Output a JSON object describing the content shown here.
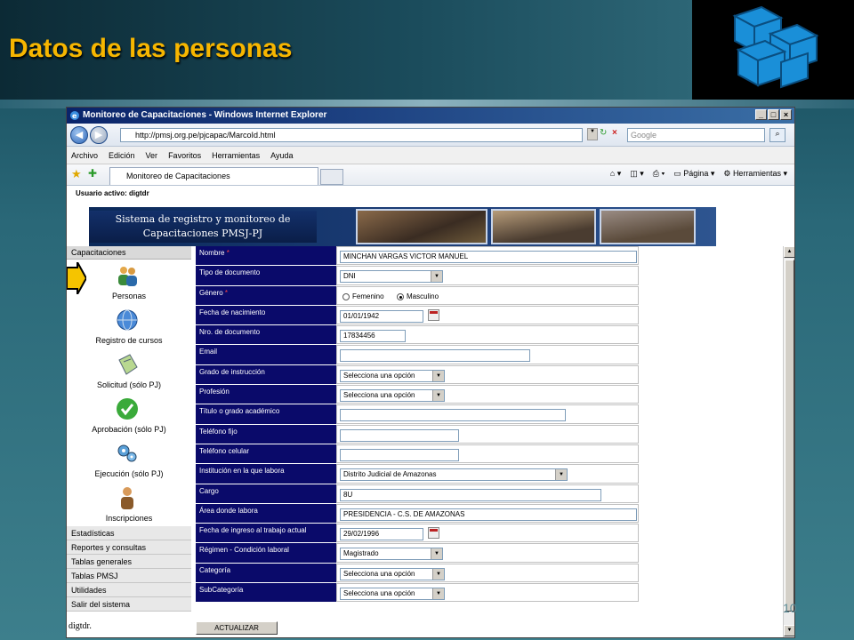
{
  "slide": {
    "title": "Datos de las personas",
    "slide_number": "10"
  },
  "browser": {
    "window_title": "Monitoreo de Capacitaciones - Windows Internet Explorer",
    "url": "http://pmsj.org.pe/pjcapac/MarcoId.html",
    "search_placeholder": "Google",
    "menu": [
      "Archivo",
      "Edición",
      "Ver",
      "Favoritos",
      "Herramientas",
      "Ayuda"
    ],
    "tab_label": "Monitoreo de Capacitaciones",
    "commands": {
      "page": "Página",
      "tools": "Herramientas"
    }
  },
  "page": {
    "user_active": "Usuario activo: digtdr",
    "banner_title": "Sistema de registro y monitoreo de Capacitaciones PMSJ-PJ",
    "footer_user": "digtdr.",
    "submit_label": "ACTUALIZAR"
  },
  "sidebar": {
    "header": "Capacitaciones",
    "icon_items": [
      {
        "label": "Personas",
        "icon": "people-icon"
      },
      {
        "label": "Registro de cursos",
        "icon": "globe-icon"
      },
      {
        "label": "Solicitud (sólo PJ)",
        "icon": "document-icon"
      },
      {
        "label": "Aprobación (sólo PJ)",
        "icon": "check-icon"
      },
      {
        "label": "Ejecución (sólo PJ)",
        "icon": "gears-icon"
      },
      {
        "label": "Inscripciones",
        "icon": "person-icon"
      }
    ],
    "links": [
      "Estadísticas",
      "Reportes y consultas",
      "Tablas generales",
      "Tablas PMSJ",
      "Utilidades",
      "Salir del sistema"
    ]
  },
  "form": {
    "nombre": {
      "label": "Nombre",
      "value": "MINCHAN VARGAS VICTOR MANUEL"
    },
    "tipo_documento": {
      "label": "Tipo de documento",
      "value": "DNI"
    },
    "genero": {
      "label": "Género",
      "option_f": "Femenino",
      "option_m": "Masculino",
      "selected": "Masculino"
    },
    "fecha_nacimiento": {
      "label": "Fecha de nacimiento",
      "value": "01/01/1942"
    },
    "nro_documento": {
      "label": "Nro. de documento",
      "value": "17834456"
    },
    "email": {
      "label": "Email",
      "value": ""
    },
    "grado_instruccion": {
      "label": "Grado de instrucción",
      "value": "Selecciona una opción"
    },
    "profesion": {
      "label": "Profesión",
      "value": "Selecciona una opción"
    },
    "titulo": {
      "label": "Título o grado académico",
      "value": ""
    },
    "telefono_fijo": {
      "label": "Teléfono fijo",
      "value": ""
    },
    "telefono_celular": {
      "label": "Teléfono celular",
      "value": ""
    },
    "institucion": {
      "label": "Institución en la que labora",
      "value": "Distrito Judicial de Amazonas"
    },
    "cargo": {
      "label": "Cargo",
      "value": "8U"
    },
    "area": {
      "label": "Área donde labora",
      "value": "PRESIDENCIA - C.S. DE AMAZONAS"
    },
    "fecha_ingreso": {
      "label": "Fecha de ingreso al trabajo actual",
      "value": "29/02/1996"
    },
    "regimen": {
      "label": "Régimen - Condición laboral",
      "value": "Magistrado"
    },
    "categoria": {
      "label": "Categoría",
      "value": "Selecciona una opción"
    },
    "subcategoria": {
      "label": "SubCategoría",
      "value": "Selecciona una opción"
    },
    "required_mark": "*"
  }
}
